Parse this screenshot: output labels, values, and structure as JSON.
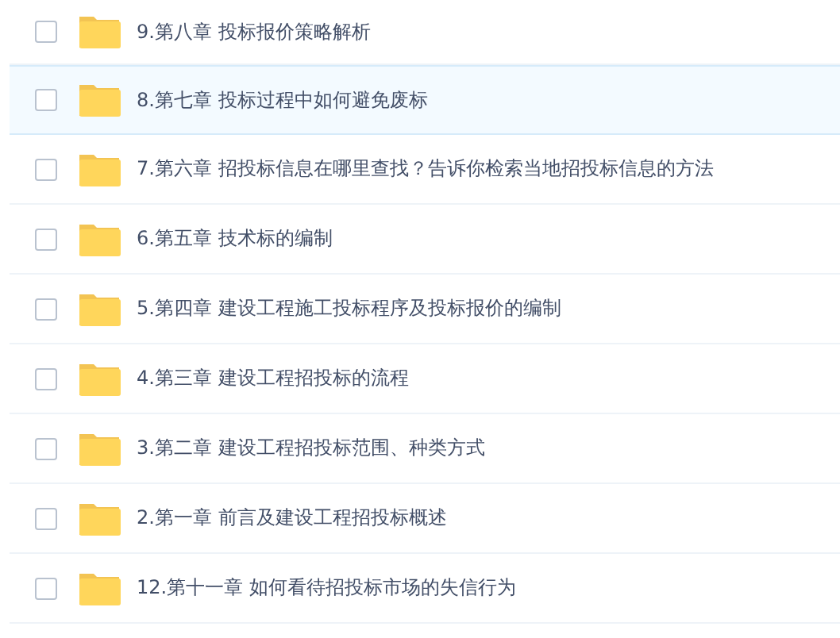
{
  "files": [
    {
      "name": "9.第八章 投标报价策略解析",
      "checked": false,
      "selected": false
    },
    {
      "name": "8.第七章 投标过程中如何避免废标",
      "checked": false,
      "selected": true
    },
    {
      "name": "7.第六章 招投标信息在哪里查找？告诉你检索当地招投标信息的方法",
      "checked": false,
      "selected": false
    },
    {
      "name": "6.第五章 技术标的编制",
      "checked": false,
      "selected": false
    },
    {
      "name": "5.第四章 建设工程施工投标程序及投标报价的编制",
      "checked": false,
      "selected": false
    },
    {
      "name": "4.第三章 建设工程招投标的流程",
      "checked": false,
      "selected": false
    },
    {
      "name": "3.第二章 建设工程招投标范围、种类方式",
      "checked": false,
      "selected": false
    },
    {
      "name": "2.第一章 前言及建设工程招投标概述",
      "checked": false,
      "selected": false
    },
    {
      "name": "12.第十一章 如何看待招投标市场的失信行为",
      "checked": false,
      "selected": false
    }
  ]
}
